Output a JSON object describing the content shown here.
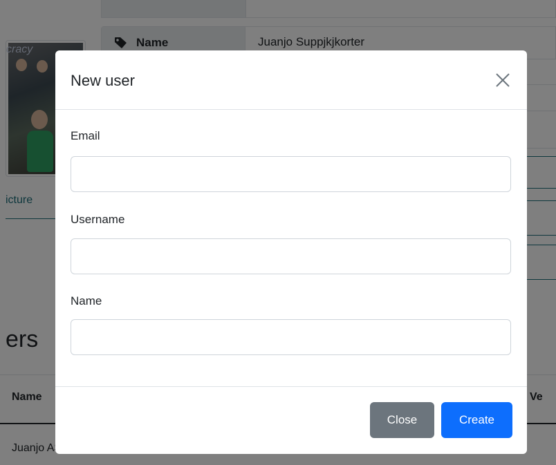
{
  "background": {
    "profile_name_label": "Name",
    "profile_name_value": "Juanjo Suppjkjkorter",
    "photo_sign_text": "cracy",
    "picture_link": "icture",
    "section_heading": "ers",
    "table_header_name": "Name",
    "table_header_right": "Ve",
    "table_row_text": "Juanjo ASL"
  },
  "modal": {
    "title": "New user",
    "fields": [
      {
        "label": "Email",
        "value": "",
        "placeholder": ""
      },
      {
        "label": "Username",
        "value": "",
        "placeholder": ""
      },
      {
        "label": "Name",
        "value": "",
        "placeholder": ""
      }
    ],
    "close_button_label": "Close",
    "create_button_label": "Create"
  },
  "colors": {
    "primary": "#0d6efd",
    "secondary": "#6c757d",
    "backdrop": "rgba(0,0,0,0.5)"
  }
}
